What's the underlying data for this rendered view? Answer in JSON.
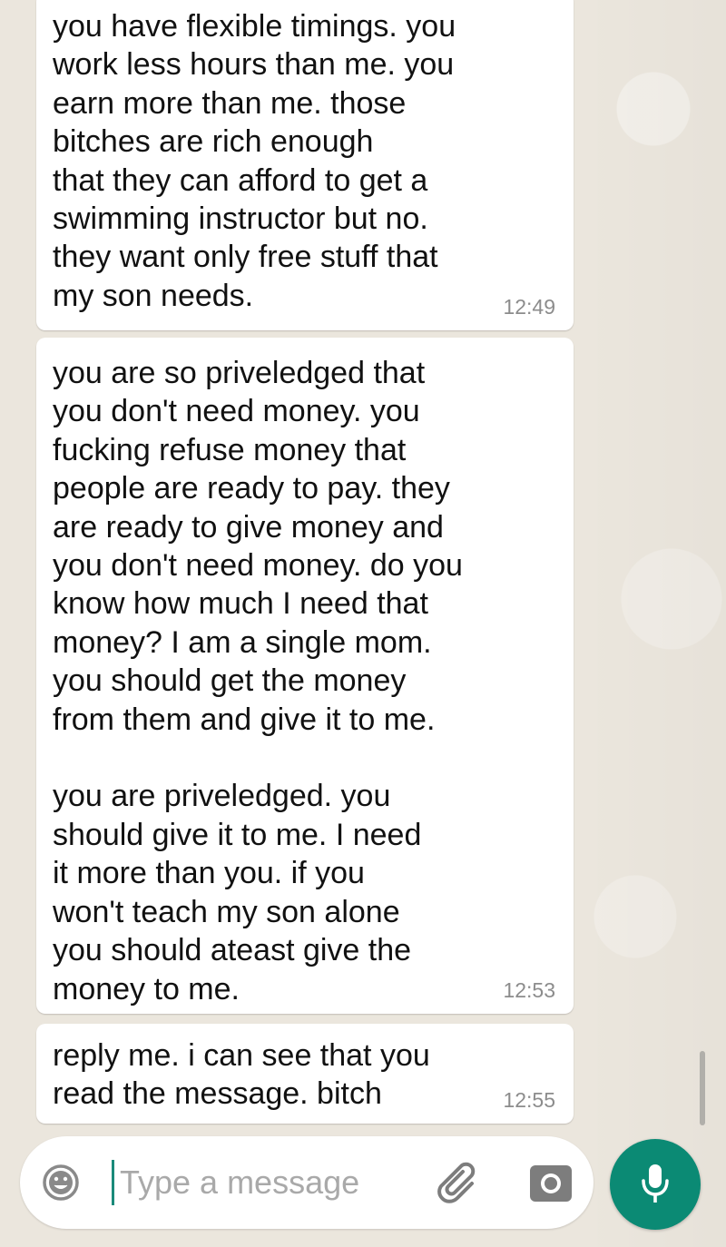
{
  "messages": [
    {
      "text": "you have flexible timings. you\nwork less hours than me. you\nearn more than me. those\nbitches are rich enough\nthat they can afford to get a\nswimming instructor but no.\nthey want only free stuff that\nmy son needs.",
      "time": "12:49"
    },
    {
      "text": "you are so priveledged that\nyou don't need money. you\nfucking refuse money that\npeople are ready to pay. they\nare ready to give money and\nyou don't need money. do you\nknow how much I need that\nmoney? I am a single mom.\nyou should get the money\nfrom them and give it to me.\n\nyou are priveledged. you\nshould give it to me. I need\nit more than you. if you\nwon't teach my son alone\nyou should ateast give the\nmoney to me.",
      "time": "12:53"
    },
    {
      "text": "reply me. i can see that you\nread the message. bitch",
      "time": "12:55"
    }
  ],
  "composer": {
    "placeholder": "Type a message",
    "value": "",
    "icons": {
      "emoji": "emoji-icon",
      "attach": "paperclip-icon",
      "camera": "camera-icon",
      "mic": "microphone-icon"
    }
  },
  "colors": {
    "chat_background": "#ebe6dd",
    "bubble": "#ffffff",
    "accent": "#0b8a74",
    "timestamp": "#8c8c8c"
  }
}
